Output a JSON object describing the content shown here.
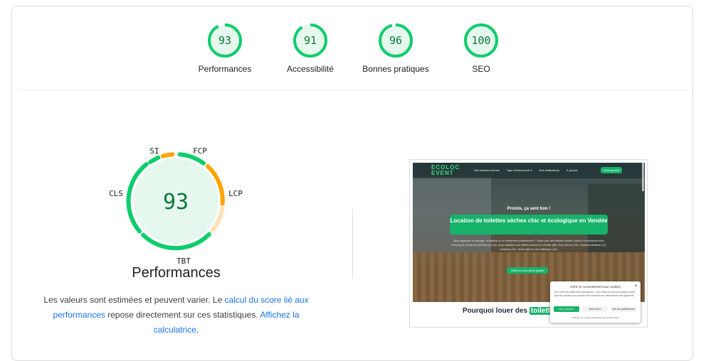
{
  "categories": [
    {
      "score": "93",
      "label": "Performances",
      "value": 93
    },
    {
      "score": "91",
      "label": "Accessibilité",
      "value": 91
    },
    {
      "score": "96",
      "label": "Bonnes pratiques",
      "value": 96
    },
    {
      "score": "100",
      "label": "SEO",
      "value": 100
    }
  ],
  "colors": {
    "pass": "#0cce6b",
    "average": "#ffa400",
    "pass_text": "#0a7a3a",
    "link": "#1a73e8"
  },
  "performance": {
    "score": "93",
    "title": "Performances",
    "metrics": {
      "si": "SI",
      "fcp": "FCP",
      "lcp": "LCP",
      "tbt": "TBT",
      "cls": "CLS"
    },
    "note": {
      "part1": "Les valeurs sont estimées et peuvent varier. Le ",
      "link1": "calcul du score lié aux performances",
      "part2": " repose directement sur ces statistiques. ",
      "link2": "Affichez la calculatrice",
      "part3": "."
    }
  },
  "screenshot": {
    "logo_line1": "ECOLOC",
    "logo_line2": "EVENT",
    "nav": [
      "Nos toilettes sèches",
      "Type d'événement ▾",
      "Nos réalisations",
      "À propos"
    ],
    "nav_button": "Devis gratuit",
    "kicker": "Promis, ça sent bon !",
    "headline": "Location de toilettes sèches chic et écologique en Vendée",
    "subtext": "Vous organisez un mariage, un festival ou un événement professionnel ? Optez pour des toilettes sèches. Basés à Bournezeau entre Fontenay-le-Comte et La Roche-sur-Yon, nous installons nos toilettes partout en Vendée (85), Deux-Sèvres (79), Charente-Maritime (17), Charente (16), Vienne (86) et Loire-Atlantique (44).",
    "cta": "Obtenez mon devis gratuit",
    "why_prefix": "Pourquoi louer des ",
    "why_highlight": "toilettes",
    "cookie": {
      "title": "Gérer le consentement aux cookies",
      "close": "✕",
      "desc": "Pour offrir les meilleures expériences, nous utilisons des technologies telles que les cookies pour stocker et/ou accéder aux informations des appareils.",
      "accept": "Oui, c'est ok !",
      "refuse": "Non merci",
      "prefs": "Voir les préférences",
      "links": "Politique de cookies   Déclaration de confidentialité"
    }
  }
}
